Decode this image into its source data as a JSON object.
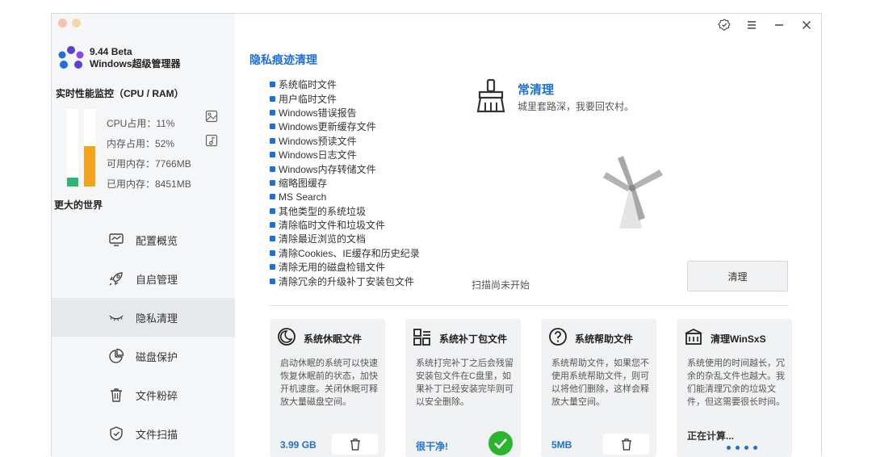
{
  "app": {
    "version": "9.44 Beta",
    "name": "Windows超级管理器"
  },
  "monitor": {
    "title": "实时性能监控（CPU / RAM）",
    "cpu_label": "CPU占用：11%",
    "mem_label": "内存占用：52%",
    "avail_label": "可用内存：7766MB",
    "used_label": "已用内存：8451MB",
    "cpu_percent": 11,
    "mem_percent": 52
  },
  "sidebar": {
    "world_label": "更大的世界",
    "items": [
      {
        "label": "配置概览"
      },
      {
        "label": "自启管理"
      },
      {
        "label": "隐私清理"
      },
      {
        "label": "磁盘保护"
      },
      {
        "label": "文件粉碎"
      },
      {
        "label": "文件扫描"
      }
    ],
    "active_index": 2
  },
  "main": {
    "title": "隐私痕迹清理",
    "items": [
      "系统临时文件",
      "用户临时文件",
      "Windows错误报告",
      "Windows更新缓存文件",
      "Windows预读文件",
      "Windows日志文件",
      "Windows内存转储文件",
      "缩略图缓存",
      "MS Search",
      "其他类型的系统垃圾",
      "清除临时文件和垃圾文件",
      "清除最近浏览的文档",
      "清除Cookies、IE缓存和历史纪录",
      "清除无用的磁盘检错文件",
      "清除冗余的升级补丁安装包文件"
    ],
    "clean_title": "常清理",
    "clean_subtitle": "城里套路深，我要回农村。",
    "scan_status": "扫描尚未开始",
    "clean_button": "清理"
  },
  "cards": [
    {
      "title": "系统休眠文件",
      "desc": "启动休眠的系统可以快速恢复休眠前的状态，加快开机速度。关闭休眠可释放大量磁盘空间。",
      "foot": "3.99 GB"
    },
    {
      "title": "系统补丁包文件",
      "desc": "系统打完补丁之后会残留安装包文件在C盘里，如果补丁已经安装完毕则可以安全删除。",
      "foot": "很干净!"
    },
    {
      "title": "系统帮助文件",
      "desc": "系统帮助文件，如果您不使用系统帮助文件，则可以将他们删除，这样会释放大量空间。",
      "foot": "5MB"
    },
    {
      "title": "清理WinSxS",
      "desc": "系统使用的时间越长，冗余的杂乱文件也越大。我们能清理冗余的垃圾文件，但这需要很长时间。",
      "foot": "正在计算..."
    }
  ],
  "colors": {
    "accent": "#1e6fd9",
    "cpu_bar": "#2bb673",
    "mem_bar": "#f3a31c",
    "success": "#2bb52e"
  }
}
